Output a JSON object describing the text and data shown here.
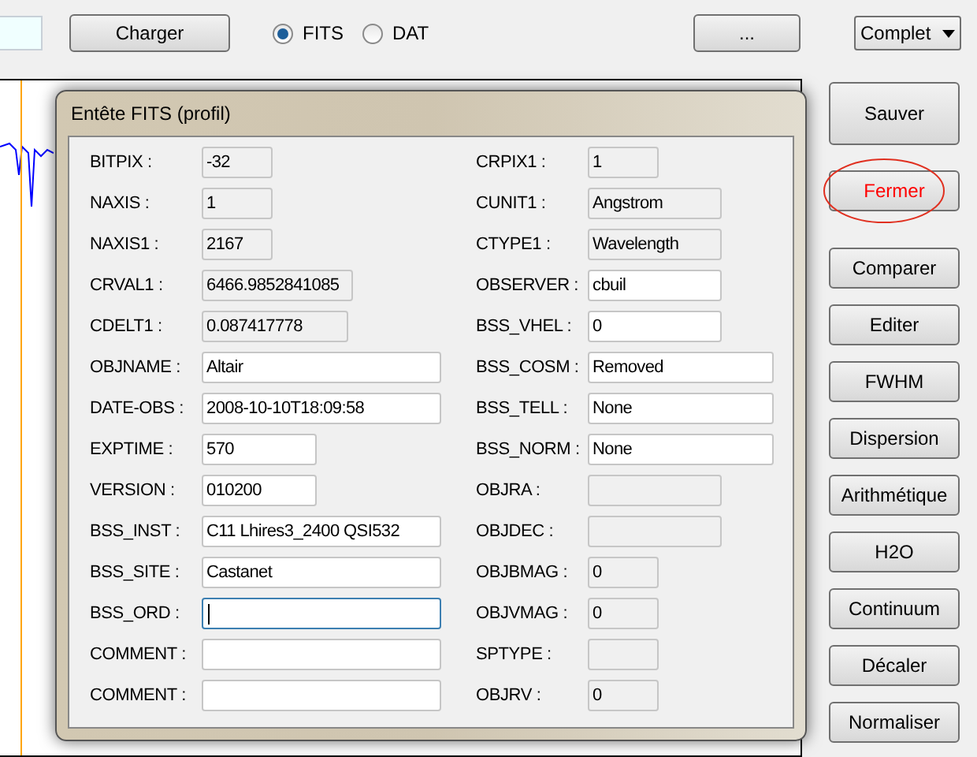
{
  "toolbar": {
    "load_button": "Charger",
    "format_options": [
      {
        "label": "FITS",
        "selected": true
      },
      {
        "label": "DAT",
        "selected": false
      }
    ],
    "browse_button": "...",
    "view_select": {
      "value": "Complet"
    }
  },
  "dialog": {
    "title": "Entête FITS (profil)",
    "left_fields": [
      {
        "label": "BITPIX :",
        "value": "-32",
        "readonly": true,
        "focused": false
      },
      {
        "label": "NAXIS :",
        "value": "1",
        "readonly": true,
        "focused": false
      },
      {
        "label": "NAXIS1 :",
        "value": "2167",
        "readonly": true,
        "focused": false
      },
      {
        "label": "CRVAL1 :",
        "value": "6466.9852841085",
        "readonly": true,
        "focused": false
      },
      {
        "label": "CDELT1 :",
        "value": "0.087417778",
        "readonly": true,
        "focused": false
      },
      {
        "label": "OBJNAME :",
        "value": "Altair",
        "readonly": false,
        "focused": false
      },
      {
        "label": "DATE-OBS :",
        "value": "2008-10-10T18:09:58",
        "readonly": false,
        "focused": false
      },
      {
        "label": "EXPTIME :",
        "value": "570",
        "readonly": false,
        "focused": false
      },
      {
        "label": "VERSION :",
        "value": "010200",
        "readonly": false,
        "focused": false
      },
      {
        "label": "BSS_INST :",
        "value": "C11 Lhires3_2400 QSI532",
        "readonly": false,
        "focused": false
      },
      {
        "label": "BSS_SITE :",
        "value": "Castanet",
        "readonly": false,
        "focused": false
      },
      {
        "label": "BSS_ORD :",
        "readonly": false,
        "focused": true
      },
      {
        "label": "COMMENT :",
        "readonly": false,
        "focused": false
      },
      {
        "label": "COMMENT :",
        "readonly": false,
        "focused": false
      }
    ],
    "right_fields": [
      {
        "label": "CRPIX1 :",
        "value": "1",
        "readonly": true,
        "focused": false
      },
      {
        "label": "CUNIT1 :",
        "value": "Angstrom",
        "readonly": true,
        "focused": false
      },
      {
        "label": "CTYPE1 :",
        "value": "Wavelength",
        "readonly": true,
        "focused": false
      },
      {
        "label": "OBSERVER :",
        "value": "cbuil",
        "readonly": false,
        "focused": false
      },
      {
        "label": "BSS_VHEL :",
        "value": "0",
        "readonly": false,
        "focused": false
      },
      {
        "label": "BSS_COSM :",
        "value": "Removed",
        "readonly": false,
        "focused": false
      },
      {
        "label": "BSS_TELL :",
        "value": "None",
        "readonly": false,
        "focused": false
      },
      {
        "label": "BSS_NORM :",
        "value": "None",
        "readonly": false,
        "focused": false
      },
      {
        "label": "OBJRA :",
        "readonly": true,
        "focused": false
      },
      {
        "label": "OBJDEC :",
        "readonly": true,
        "focused": false
      },
      {
        "label": "OBJBMAG :",
        "value": "0",
        "readonly": true,
        "focused": false
      },
      {
        "label": "OBJVMAG :",
        "value": "0",
        "readonly": true,
        "focused": false
      },
      {
        "label": "SPTYPE :",
        "readonly": true,
        "focused": false
      },
      {
        "label": "OBJRV :",
        "value": "0",
        "readonly": true,
        "focused": false
      }
    ]
  },
  "side_buttons": [
    {
      "label": "Sauver",
      "circled": false
    },
    {
      "label": "Fermer",
      "circled": true
    },
    {
      "label": "Comparer",
      "circled": false
    },
    {
      "label": "Editer",
      "circled": false
    },
    {
      "label": "FWHM",
      "circled": false
    },
    {
      "label": "Dispersion",
      "circled": false
    },
    {
      "label": "Arithmétique",
      "circled": false
    },
    {
      "label": "H2O",
      "circled": false
    },
    {
      "label": "Continuum",
      "circled": false
    },
    {
      "label": "Décaler",
      "circled": false
    },
    {
      "label": "Normaliser",
      "circled": false
    }
  ]
}
